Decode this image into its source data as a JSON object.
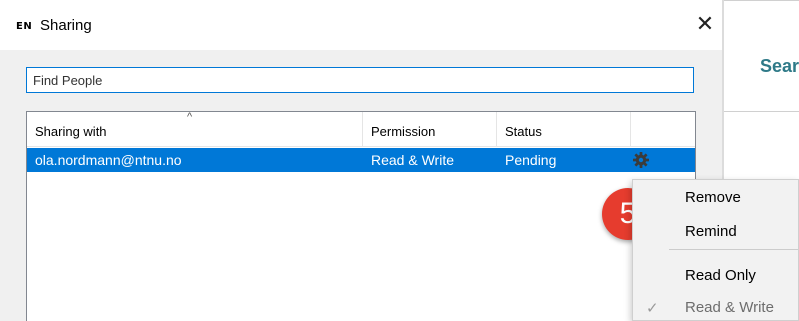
{
  "window": {
    "app_badge": "EN",
    "title": "Sharing",
    "close_glyph": "✕"
  },
  "search": {
    "value": "",
    "placeholder": "Find People"
  },
  "table": {
    "columns": [
      "Sharing with",
      "Permission",
      "Status",
      ""
    ],
    "sort_indicator": "ascending",
    "rows": [
      {
        "email": "ola.nordmann@ntnu.no",
        "permission": "Read & Write",
        "status": "Pending",
        "selected": true
      }
    ]
  },
  "context_menu": {
    "items": [
      {
        "label": "Remove",
        "disabled": false,
        "checked": false
      },
      {
        "label": "Remind",
        "disabled": false,
        "checked": false
      },
      {
        "label": "Read Only",
        "disabled": false,
        "checked": false
      },
      {
        "label": "Read & Write",
        "disabled": true,
        "checked": true
      }
    ]
  },
  "callout": {
    "number": "5",
    "color": "#e63c2e"
  },
  "background_pane": {
    "heading": "Sear"
  },
  "colors": {
    "selection": "#0078d7",
    "heading": "#2f7a88"
  }
}
